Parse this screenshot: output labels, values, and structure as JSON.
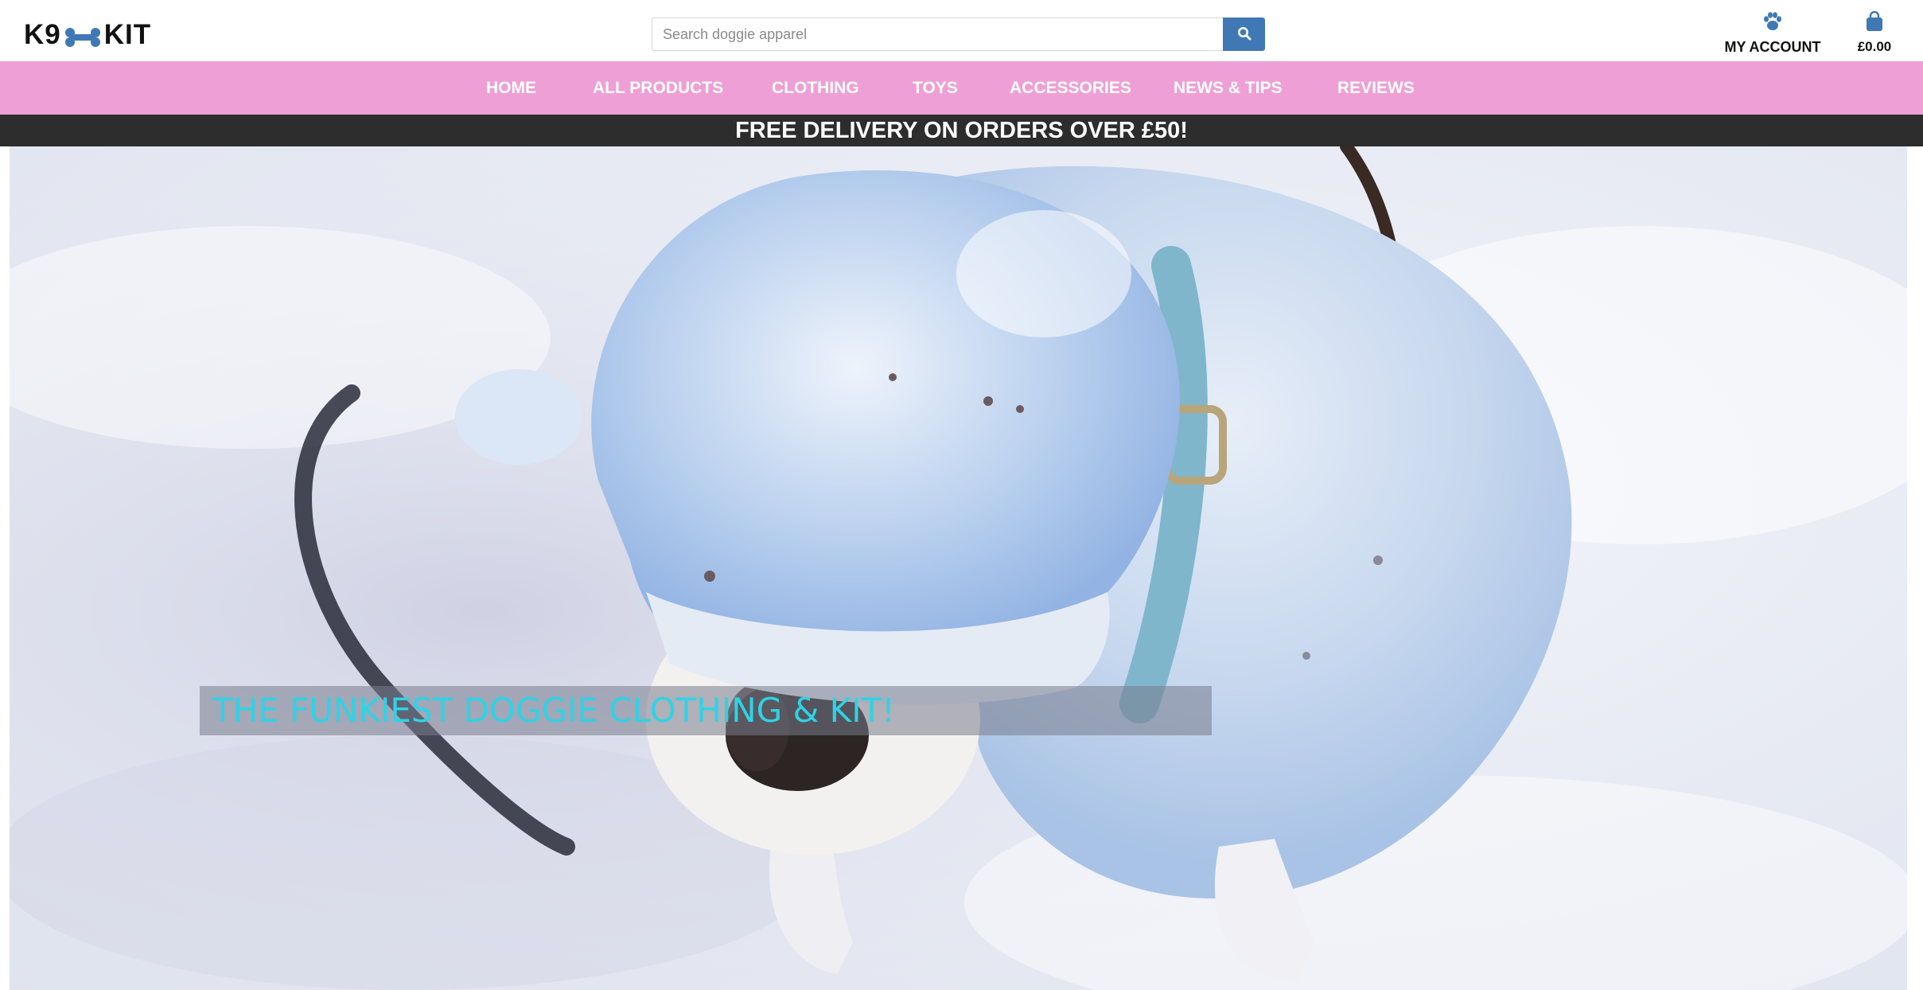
{
  "header": {
    "logo_left": "K9",
    "logo_right": "KIT",
    "search": {
      "placeholder": "Search doggie apparel",
      "value": ""
    },
    "account_label": "MY ACCOUNT",
    "cart_total": "£0.00"
  },
  "nav": {
    "items": [
      {
        "label": "HOME"
      },
      {
        "label": "ALL PRODUCTS"
      },
      {
        "label": "CLOTHING"
      },
      {
        "label": "TOYS"
      },
      {
        "label": "ACCESSORIES"
      },
      {
        "label": "NEWS & TIPS"
      },
      {
        "label": "REVIEWS"
      }
    ]
  },
  "banner": {
    "text": "FREE DELIVERY ON ORDERS OVER £50!"
  },
  "hero": {
    "caption": "THE FUNKIEST DOGGIE CLOTHING & KIT!"
  },
  "icons": {
    "logo_bone": "bone-icon",
    "search": "search-icon",
    "account": "paw-icon",
    "cart": "shopping-bag-icon"
  },
  "colors": {
    "nav_background": "#ee9fd6",
    "banner_background": "#2d2d2d",
    "search_button": "#3f78b5",
    "icon_blue": "#3f78b5",
    "caption_text": "#2ed3e6"
  }
}
